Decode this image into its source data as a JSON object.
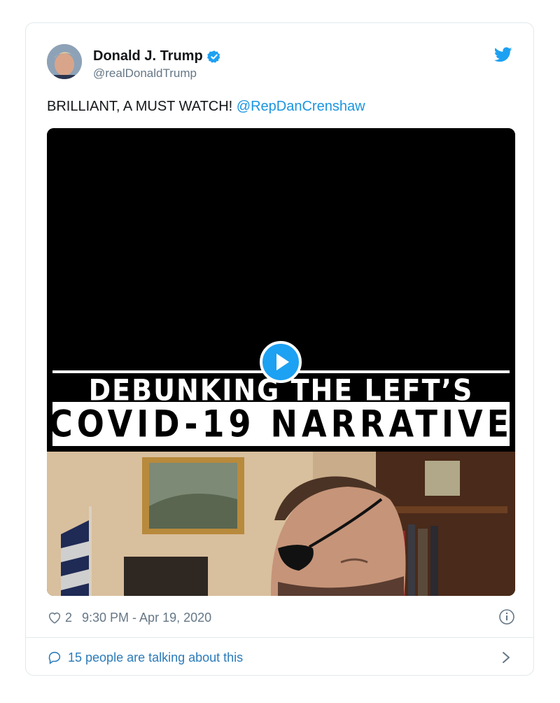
{
  "tweet": {
    "author_name": "Donald J. Trump",
    "author_handle": "@realDonaldTrump",
    "text": "BRILLIANT, A MUST WATCH! ",
    "mention": "@RepDanCrenshaw",
    "icons": {
      "verified": "verified-badge-icon",
      "brand": "twitter-bird-icon",
      "avatar": "avatar"
    }
  },
  "video": {
    "line1": "DEBUNKING THE LEFT’S",
    "line2": "COVID-19 NARRATIVE",
    "icons": {
      "play": "play-icon"
    }
  },
  "meta": {
    "likes": "2",
    "timestamp": "9:30 PM - Apr 19, 2020",
    "icons": {
      "like": "heart-icon",
      "info": "info-icon"
    }
  },
  "footer": {
    "talking": "15 people are talking about this",
    "icons": {
      "reply": "speech-bubble-icon",
      "more": "chevron-right-icon"
    }
  },
  "colors": {
    "link": "#1b95e0",
    "muted": "#657786",
    "text": "#14171a",
    "border": "#e1e8ed"
  }
}
